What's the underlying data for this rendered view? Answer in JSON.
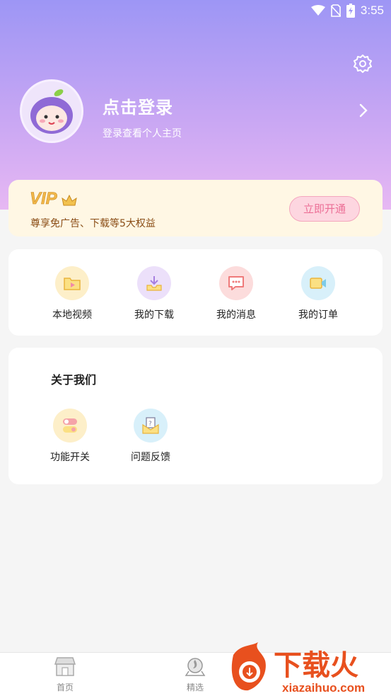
{
  "status_bar": {
    "time": "3:55"
  },
  "profile": {
    "title": "点击登录",
    "subtitle": "登录查看个人主页"
  },
  "vip": {
    "badge": "VIP",
    "description": "尊享免广告、下载等5大权益",
    "button": "立即开通"
  },
  "shortcuts": [
    {
      "label": "本地视频",
      "icon": "folder-video-icon"
    },
    {
      "label": "我的下载",
      "icon": "download-tray-icon"
    },
    {
      "label": "我的消息",
      "icon": "message-bubble-icon"
    },
    {
      "label": "我的订单",
      "icon": "video-camera-icon"
    }
  ],
  "about": {
    "title": "关于我们",
    "items": [
      {
        "label": "功能开关",
        "icon": "toggle-switch-icon"
      },
      {
        "label": "问题反馈",
        "icon": "feedback-question-icon"
      }
    ]
  },
  "tabbar": {
    "items": [
      {
        "label": "首页",
        "icon": "home-store-icon"
      },
      {
        "label": "精选",
        "icon": "featured-badge-icon"
      }
    ]
  },
  "watermark": {
    "brand": "下载火",
    "domain": "xiazaihuo.com"
  },
  "colors": {
    "header_top": "#9d96f5",
    "header_bottom": "#e7b8f3",
    "vip_bg": "#fff7e4",
    "vip_text": "#8a4d16",
    "vip_button": "#ec6f96",
    "watermark": "#e8501e"
  }
}
